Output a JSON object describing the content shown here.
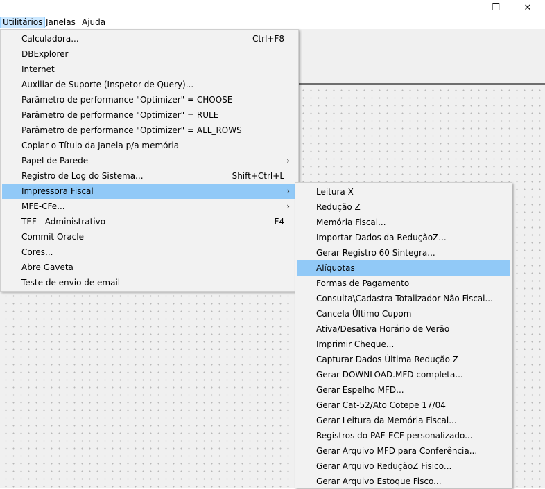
{
  "window": {
    "minimize_glyph": "—",
    "restore_glyph": "❐",
    "close_glyph": "✕"
  },
  "menubar": {
    "items": [
      {
        "label": "Utilitários"
      },
      {
        "label": "Janelas"
      },
      {
        "label": "Ajuda"
      }
    ]
  },
  "utilitarios_menu": {
    "items": [
      {
        "label": "Calculadora...",
        "shortcut": "Ctrl+F8",
        "arrow": ""
      },
      {
        "label": "DBExplorer",
        "shortcut": "",
        "arrow": ""
      },
      {
        "label": "Internet",
        "shortcut": "",
        "arrow": ""
      },
      {
        "label": "Auxiliar de Suporte (Inspetor de Query)...",
        "shortcut": "",
        "arrow": ""
      },
      {
        "label": "Parâmetro de performance \"Optimizer\" = CHOOSE",
        "shortcut": "",
        "arrow": ""
      },
      {
        "label": "Parâmetro de performance \"Optimizer\" = RULE",
        "shortcut": "",
        "arrow": ""
      },
      {
        "label": "Parâmetro de performance \"Optimizer\" = ALL_ROWS",
        "shortcut": "",
        "arrow": ""
      },
      {
        "label": "Copiar o Título da Janela p/a memória",
        "shortcut": "",
        "arrow": ""
      },
      {
        "label": "Papel de Parede",
        "shortcut": "",
        "arrow": "›"
      },
      {
        "label": "Registro de Log do Sistema...",
        "shortcut": "Shift+Ctrl+L",
        "arrow": ""
      },
      {
        "label": "Impressora Fiscal",
        "shortcut": "",
        "arrow": "›",
        "highlighted": true
      },
      {
        "label": "MFE-CFe...",
        "shortcut": "",
        "arrow": "›"
      },
      {
        "label": "TEF - Administrativo",
        "shortcut": "F4",
        "arrow": ""
      },
      {
        "label": "Commit Oracle",
        "shortcut": "",
        "arrow": ""
      },
      {
        "label": "Cores...",
        "shortcut": "",
        "arrow": ""
      },
      {
        "label": "Abre Gaveta",
        "shortcut": "",
        "arrow": ""
      },
      {
        "label": "Teste de envio de email",
        "shortcut": "",
        "arrow": ""
      }
    ]
  },
  "impressora_fiscal_menu": {
    "items": [
      {
        "label": "Leitura X"
      },
      {
        "label": "Redução Z"
      },
      {
        "label": "Memória Fiscal..."
      },
      {
        "label": "Importar Dados da ReduçãoZ..."
      },
      {
        "label": "Gerar Registro 60 Sintegra..."
      },
      {
        "label": "Alíquotas",
        "highlighted": true
      },
      {
        "label": "Formas de Pagamento"
      },
      {
        "label": "Consulta\\Cadastra Totalizador Não Fiscal..."
      },
      {
        "label": "Cancela Último Cupom"
      },
      {
        "label": "Ativa/Desativa Horário de Verão"
      },
      {
        "label": "Imprimir Cheque..."
      },
      {
        "label": "Capturar Dados Última Redução Z"
      },
      {
        "label": "Gerar DOWNLOAD.MFD completa..."
      },
      {
        "label": "Gerar Espelho MFD..."
      },
      {
        "label": "Gerar Cat-52/Ato Cotepe 17/04"
      },
      {
        "label": "Gerar Leitura da Memória Fiscal..."
      },
      {
        "label": "Registros do PAF-ECF personalizado..."
      },
      {
        "label": "Gerar Arquivo MFD para Conferência..."
      },
      {
        "label": "Gerar Arquivo ReduçãoZ Fisico..."
      },
      {
        "label": "Gerar Arquivo Estoque Fisco..."
      }
    ]
  },
  "colors": {
    "highlight": "#91c9f7",
    "menubar_active": "#cce8ff",
    "menu_background": "#f2f2f2"
  }
}
